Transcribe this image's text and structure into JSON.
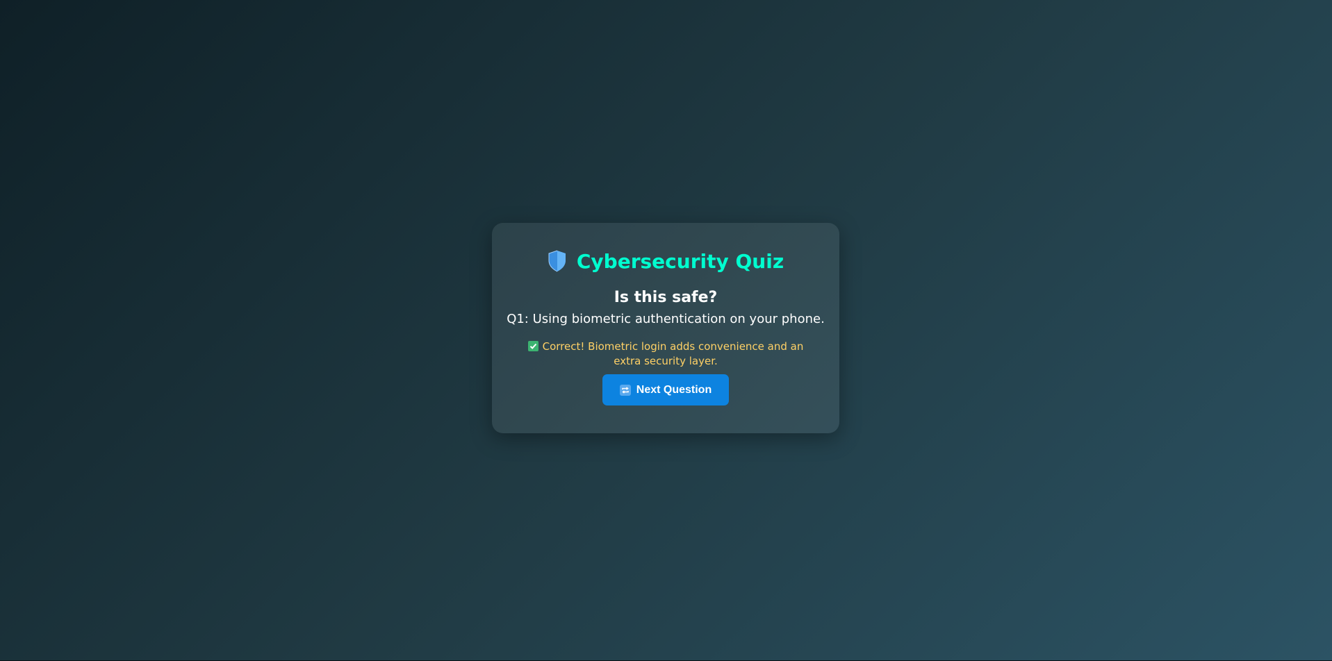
{
  "quiz": {
    "title": "Cybersecurity Quiz",
    "heading": "Is this safe?",
    "question": "Q1: Using biometric authentication on your phone.",
    "feedback": "Correct! Biometric login adds convenience and an extra security layer.",
    "next_button_label": "Next Question"
  },
  "icons": {
    "title_icon": "shield-icon",
    "feedback_icon": "check-mark-icon",
    "button_icon": "repeat-icon"
  },
  "colors": {
    "title": "#00ffd0",
    "feedback": "#ffd166",
    "button": "#0d83e0",
    "check": "#3cb371"
  }
}
